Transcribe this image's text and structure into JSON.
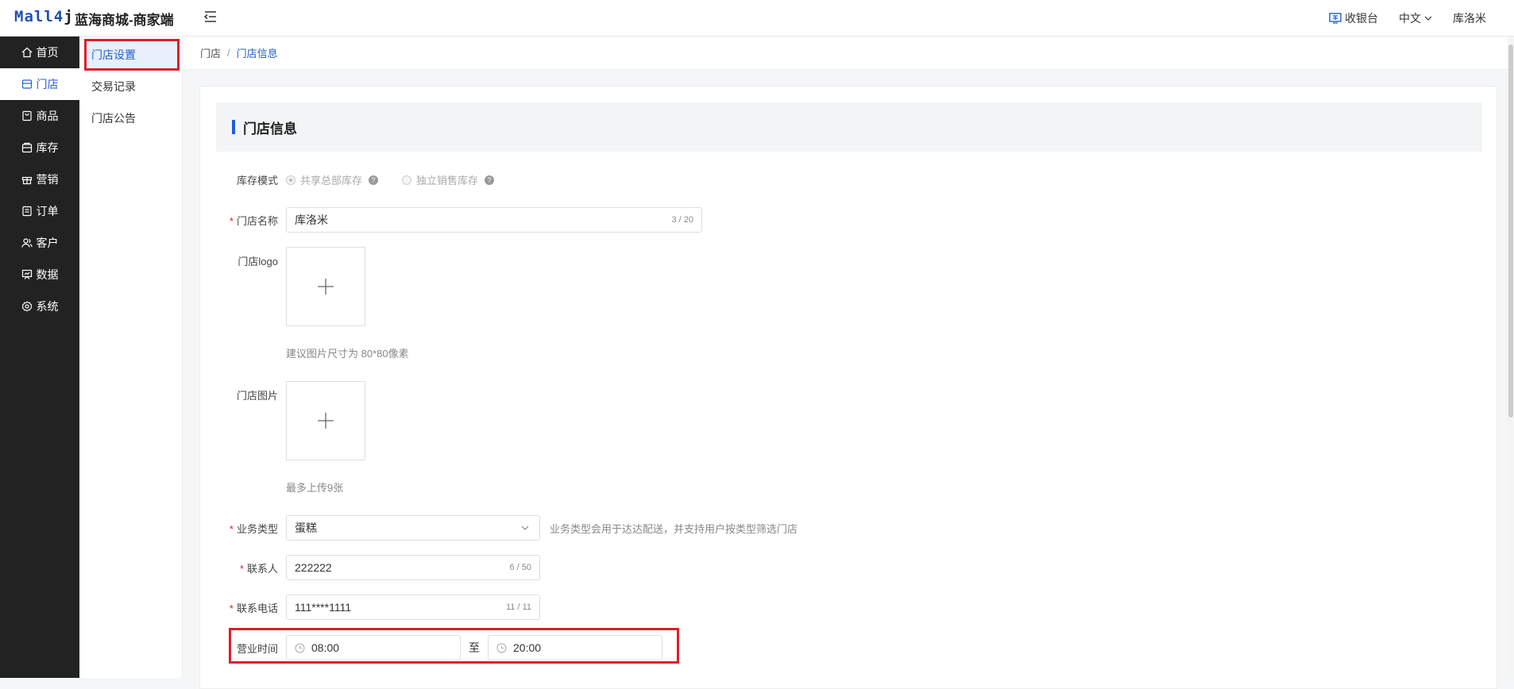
{
  "header": {
    "logo_main": "Mall4",
    "logo_tail": "j",
    "app_title": "蓝海商城-商家端",
    "cashier": "收银台",
    "language": "中文",
    "username": "库洛米"
  },
  "sidebar": {
    "items": [
      {
        "label": "首页",
        "icon": "home-icon"
      },
      {
        "label": "门店",
        "icon": "store-icon"
      },
      {
        "label": "商品",
        "icon": "goods-icon"
      },
      {
        "label": "库存",
        "icon": "inventory-icon"
      },
      {
        "label": "营销",
        "icon": "gift-icon"
      },
      {
        "label": "订单",
        "icon": "order-icon"
      },
      {
        "label": "客户",
        "icon": "customer-icon"
      },
      {
        "label": "数据",
        "icon": "data-icon"
      },
      {
        "label": "系统",
        "icon": "system-icon"
      }
    ]
  },
  "subnav": {
    "items": [
      {
        "label": "门店设置"
      },
      {
        "label": "交易记录"
      },
      {
        "label": "门店公告"
      }
    ]
  },
  "breadcrumb": {
    "root": "门店",
    "sep": "/",
    "current": "门店信息"
  },
  "form": {
    "section_title": "门店信息",
    "stock_mode": {
      "label": "库存模式",
      "option1": "共享总部库存",
      "option2": "独立销售库存"
    },
    "store_name": {
      "label": "门店名称",
      "value": "库洛米",
      "count": "3 / 20"
    },
    "store_logo": {
      "label": "门店logo",
      "hint": "建议图片尺寸为 80*80像素"
    },
    "store_image": {
      "label": "门店图片",
      "hint": "最多上传9张"
    },
    "business_type": {
      "label": "业务类型",
      "value": "蛋糕",
      "hint": "业务类型会用于达达配送，并支持用户按类型筛选门店"
    },
    "contact": {
      "label": "联系人",
      "value": "222222",
      "count": "6 / 50"
    },
    "phone": {
      "label": "联系电话",
      "value": "111****1111",
      "count": "11 / 11"
    },
    "business_hours": {
      "label": "营业时间",
      "start": "08:00",
      "to": "至",
      "end": "20:00"
    }
  },
  "colors": {
    "accent": "#1f5fd6",
    "sidebar_bg": "#222222",
    "highlight_red": "#e01e2b"
  }
}
